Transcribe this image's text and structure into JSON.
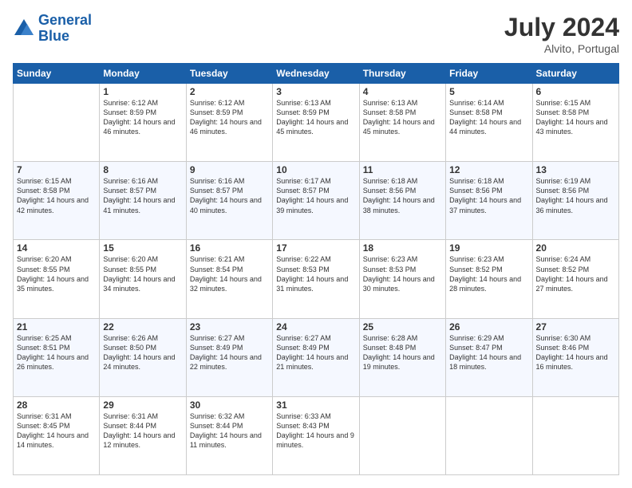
{
  "header": {
    "logo_line1": "General",
    "logo_line2": "Blue",
    "month": "July 2024",
    "location": "Alvito, Portugal"
  },
  "days_of_week": [
    "Sunday",
    "Monday",
    "Tuesday",
    "Wednesday",
    "Thursday",
    "Friday",
    "Saturday"
  ],
  "weeks": [
    [
      {
        "day": "",
        "sunrise": "",
        "sunset": "",
        "daylight": ""
      },
      {
        "day": "1",
        "sunrise": "Sunrise: 6:12 AM",
        "sunset": "Sunset: 8:59 PM",
        "daylight": "Daylight: 14 hours and 46 minutes."
      },
      {
        "day": "2",
        "sunrise": "Sunrise: 6:12 AM",
        "sunset": "Sunset: 8:59 PM",
        "daylight": "Daylight: 14 hours and 46 minutes."
      },
      {
        "day": "3",
        "sunrise": "Sunrise: 6:13 AM",
        "sunset": "Sunset: 8:59 PM",
        "daylight": "Daylight: 14 hours and 45 minutes."
      },
      {
        "day": "4",
        "sunrise": "Sunrise: 6:13 AM",
        "sunset": "Sunset: 8:58 PM",
        "daylight": "Daylight: 14 hours and 45 minutes."
      },
      {
        "day": "5",
        "sunrise": "Sunrise: 6:14 AM",
        "sunset": "Sunset: 8:58 PM",
        "daylight": "Daylight: 14 hours and 44 minutes."
      },
      {
        "day": "6",
        "sunrise": "Sunrise: 6:15 AM",
        "sunset": "Sunset: 8:58 PM",
        "daylight": "Daylight: 14 hours and 43 minutes."
      }
    ],
    [
      {
        "day": "7",
        "sunrise": "Sunrise: 6:15 AM",
        "sunset": "Sunset: 8:58 PM",
        "daylight": "Daylight: 14 hours and 42 minutes."
      },
      {
        "day": "8",
        "sunrise": "Sunrise: 6:16 AM",
        "sunset": "Sunset: 8:57 PM",
        "daylight": "Daylight: 14 hours and 41 minutes."
      },
      {
        "day": "9",
        "sunrise": "Sunrise: 6:16 AM",
        "sunset": "Sunset: 8:57 PM",
        "daylight": "Daylight: 14 hours and 40 minutes."
      },
      {
        "day": "10",
        "sunrise": "Sunrise: 6:17 AM",
        "sunset": "Sunset: 8:57 PM",
        "daylight": "Daylight: 14 hours and 39 minutes."
      },
      {
        "day": "11",
        "sunrise": "Sunrise: 6:18 AM",
        "sunset": "Sunset: 8:56 PM",
        "daylight": "Daylight: 14 hours and 38 minutes."
      },
      {
        "day": "12",
        "sunrise": "Sunrise: 6:18 AM",
        "sunset": "Sunset: 8:56 PM",
        "daylight": "Daylight: 14 hours and 37 minutes."
      },
      {
        "day": "13",
        "sunrise": "Sunrise: 6:19 AM",
        "sunset": "Sunset: 8:56 PM",
        "daylight": "Daylight: 14 hours and 36 minutes."
      }
    ],
    [
      {
        "day": "14",
        "sunrise": "Sunrise: 6:20 AM",
        "sunset": "Sunset: 8:55 PM",
        "daylight": "Daylight: 14 hours and 35 minutes."
      },
      {
        "day": "15",
        "sunrise": "Sunrise: 6:20 AM",
        "sunset": "Sunset: 8:55 PM",
        "daylight": "Daylight: 14 hours and 34 minutes."
      },
      {
        "day": "16",
        "sunrise": "Sunrise: 6:21 AM",
        "sunset": "Sunset: 8:54 PM",
        "daylight": "Daylight: 14 hours and 32 minutes."
      },
      {
        "day": "17",
        "sunrise": "Sunrise: 6:22 AM",
        "sunset": "Sunset: 8:53 PM",
        "daylight": "Daylight: 14 hours and 31 minutes."
      },
      {
        "day": "18",
        "sunrise": "Sunrise: 6:23 AM",
        "sunset": "Sunset: 8:53 PM",
        "daylight": "Daylight: 14 hours and 30 minutes."
      },
      {
        "day": "19",
        "sunrise": "Sunrise: 6:23 AM",
        "sunset": "Sunset: 8:52 PM",
        "daylight": "Daylight: 14 hours and 28 minutes."
      },
      {
        "day": "20",
        "sunrise": "Sunrise: 6:24 AM",
        "sunset": "Sunset: 8:52 PM",
        "daylight": "Daylight: 14 hours and 27 minutes."
      }
    ],
    [
      {
        "day": "21",
        "sunrise": "Sunrise: 6:25 AM",
        "sunset": "Sunset: 8:51 PM",
        "daylight": "Daylight: 14 hours and 26 minutes."
      },
      {
        "day": "22",
        "sunrise": "Sunrise: 6:26 AM",
        "sunset": "Sunset: 8:50 PM",
        "daylight": "Daylight: 14 hours and 24 minutes."
      },
      {
        "day": "23",
        "sunrise": "Sunrise: 6:27 AM",
        "sunset": "Sunset: 8:49 PM",
        "daylight": "Daylight: 14 hours and 22 minutes."
      },
      {
        "day": "24",
        "sunrise": "Sunrise: 6:27 AM",
        "sunset": "Sunset: 8:49 PM",
        "daylight": "Daylight: 14 hours and 21 minutes."
      },
      {
        "day": "25",
        "sunrise": "Sunrise: 6:28 AM",
        "sunset": "Sunset: 8:48 PM",
        "daylight": "Daylight: 14 hours and 19 minutes."
      },
      {
        "day": "26",
        "sunrise": "Sunrise: 6:29 AM",
        "sunset": "Sunset: 8:47 PM",
        "daylight": "Daylight: 14 hours and 18 minutes."
      },
      {
        "day": "27",
        "sunrise": "Sunrise: 6:30 AM",
        "sunset": "Sunset: 8:46 PM",
        "daylight": "Daylight: 14 hours and 16 minutes."
      }
    ],
    [
      {
        "day": "28",
        "sunrise": "Sunrise: 6:31 AM",
        "sunset": "Sunset: 8:45 PM",
        "daylight": "Daylight: 14 hours and 14 minutes."
      },
      {
        "day": "29",
        "sunrise": "Sunrise: 6:31 AM",
        "sunset": "Sunset: 8:44 PM",
        "daylight": "Daylight: 14 hours and 12 minutes."
      },
      {
        "day": "30",
        "sunrise": "Sunrise: 6:32 AM",
        "sunset": "Sunset: 8:44 PM",
        "daylight": "Daylight: 14 hours and 11 minutes."
      },
      {
        "day": "31",
        "sunrise": "Sunrise: 6:33 AM",
        "sunset": "Sunset: 8:43 PM",
        "daylight": "Daylight: 14 hours and 9 minutes."
      },
      {
        "day": "",
        "sunrise": "",
        "sunset": "",
        "daylight": ""
      },
      {
        "day": "",
        "sunrise": "",
        "sunset": "",
        "daylight": ""
      },
      {
        "day": "",
        "sunrise": "",
        "sunset": "",
        "daylight": ""
      }
    ]
  ]
}
